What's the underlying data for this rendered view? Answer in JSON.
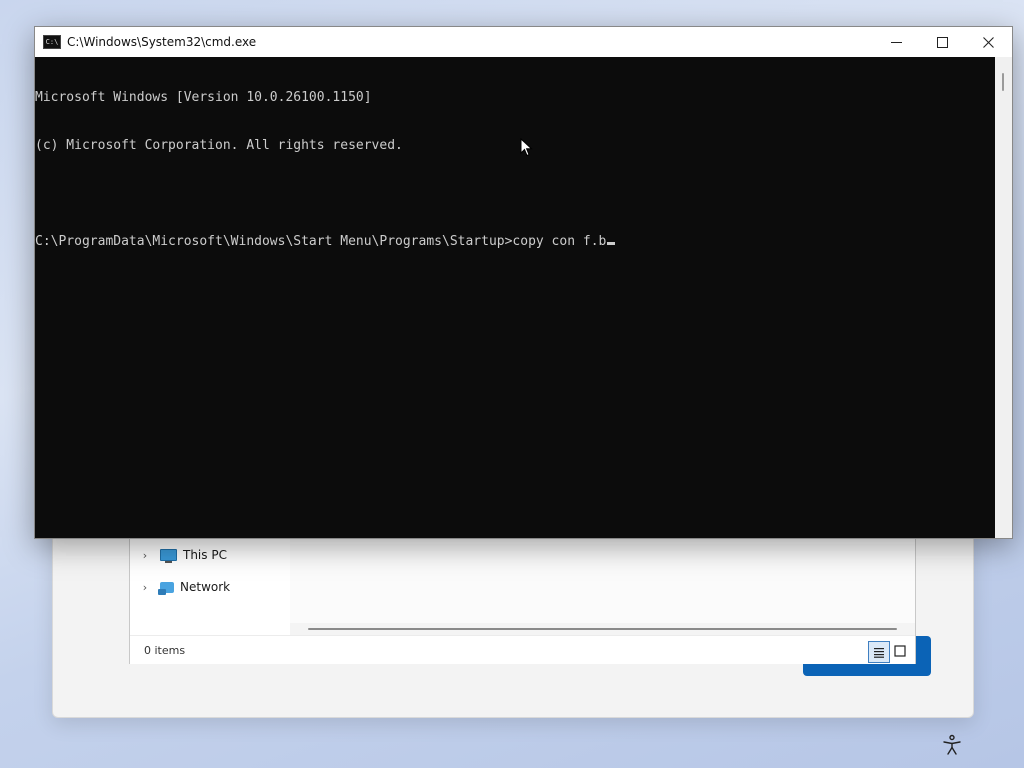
{
  "cmd_window": {
    "title": "C:\\Windows\\System32\\cmd.exe",
    "icon": "cmd-icon",
    "controls": {
      "minimize": "minimize-icon",
      "maximize": "maximize-icon",
      "close": "close-icon"
    },
    "lines": [
      "Microsoft Windows [Version 10.0.26100.1150]",
      "(c) Microsoft Corporation. All rights reserved.",
      "",
      "C:\\ProgramData\\Microsoft\\Windows\\Start Menu\\Programs\\Startup>copy con f.b"
    ]
  },
  "explorer": {
    "nav_items": [
      {
        "label": "This PC",
        "icon": "this-pc-icon"
      },
      {
        "label": "Network",
        "icon": "network-icon"
      }
    ],
    "status": {
      "item_count": "0 items"
    }
  },
  "colors": {
    "console_bg": "#0c0c0c",
    "console_fg": "#cccccc",
    "accent_button": "#0b63b6",
    "desktop_bg": "#c9d6ee"
  }
}
